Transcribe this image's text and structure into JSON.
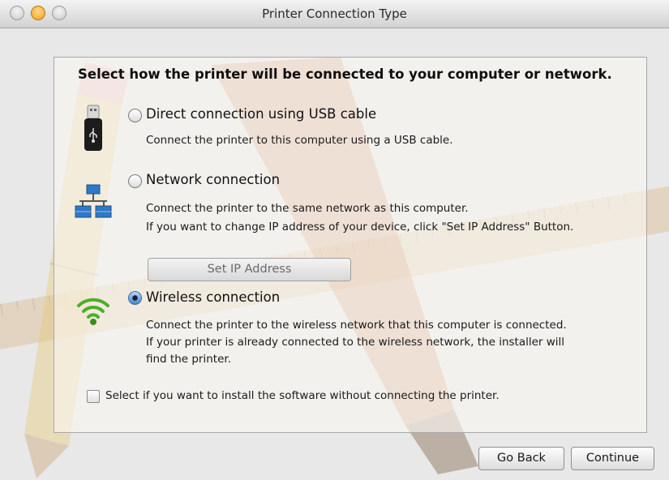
{
  "window": {
    "title": "Printer Connection Type"
  },
  "heading": "Select how the printer will be connected to your computer or network.",
  "options": [
    {
      "icon": "usb-drive-icon",
      "title": "Direct connection using USB cable",
      "description": [
        "Connect the printer to this computer using a USB cable."
      ],
      "selected": false
    },
    {
      "icon": "network-icon",
      "title": "Network connection",
      "description": [
        "Connect the printer to the same network as this computer.",
        "If you want to change IP address of your device, click \"Set IP Address\" Button."
      ],
      "selected": false
    },
    {
      "icon": "wifi-icon",
      "title": "Wireless connection",
      "description": [
        "Connect the printer to the wireless network that this computer is connected.",
        "If your printer is already connected to the wireless network, the installer will",
        "find the printer."
      ],
      "selected": true
    }
  ],
  "set_ip_button": {
    "label": "Set IP Address",
    "enabled": false
  },
  "install_without_connecting": {
    "label": "Select if you want to install the software without connecting the printer.",
    "checked": false
  },
  "footer": {
    "back_label": "Go Back",
    "continue_label": "Continue"
  },
  "colors": {
    "accent_radio": "#3f86d4",
    "wifi_green": "#4caf2a",
    "network_blue": "#2f78c4"
  }
}
